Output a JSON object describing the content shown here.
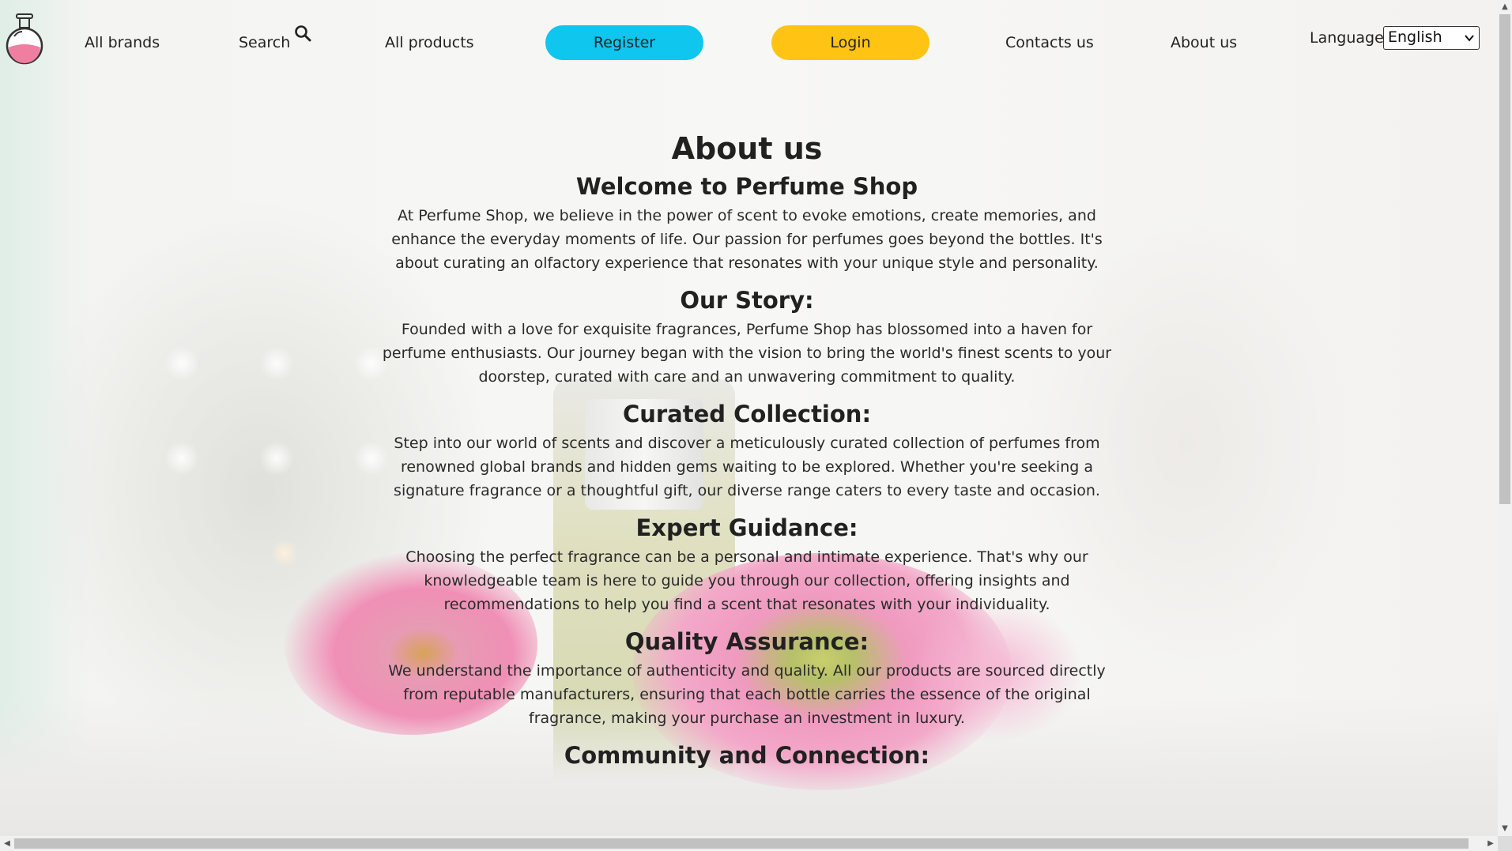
{
  "nav": {
    "all_brands": "All brands",
    "search": "Search",
    "all_products": "All products",
    "register": "Register",
    "login": "Login",
    "contacts": "Contacts us",
    "about": "About us",
    "language_label": "Language",
    "language_value": "English"
  },
  "colors": {
    "register_bg": "#0ec6ee",
    "login_bg": "#ffc413"
  },
  "icons": {
    "logo": "perfume-bottle-logo-icon",
    "search": "search-icon",
    "dropdown": "chevron-down-icon"
  },
  "content": {
    "title": "About us",
    "welcome_heading": "Welcome to Perfume Shop",
    "welcome_text": "At Perfume Shop, we believe in the power of scent to evoke emotions, create memories, and enhance the everyday moments of life. Our passion for perfumes goes beyond the bottles. It's about curating an olfactory experience that resonates with your unique style and personality.",
    "sections": [
      {
        "heading": "Our Story:",
        "text": "Founded with a love for exquisite fragrances, Perfume Shop has blossomed into a haven for perfume enthusiasts. Our journey began with the vision to bring the world's finest scents to your doorstep, curated with care and an unwavering commitment to quality."
      },
      {
        "heading": "Curated Collection:",
        "text": "Step into our world of scents and discover a meticulously curated collection of perfumes from renowned global brands and hidden gems waiting to be explored. Whether you're seeking a signature fragrance or a thoughtful gift, our diverse range caters to every taste and occasion."
      },
      {
        "heading": "Expert Guidance:",
        "text": "Choosing the perfect fragrance can be a personal and intimate experience. That's why our knowledgeable team is here to guide you through our collection, offering insights and recommendations to help you find a scent that resonates with your individuality."
      },
      {
        "heading": "Quality Assurance:",
        "text": "We understand the importance of authenticity and quality. All our products are sourced directly from reputable manufacturers, ensuring that each bottle carries the essence of the original fragrance, making your purchase an investment in luxury."
      },
      {
        "heading": "Community and Connection:",
        "text": ""
      }
    ]
  }
}
